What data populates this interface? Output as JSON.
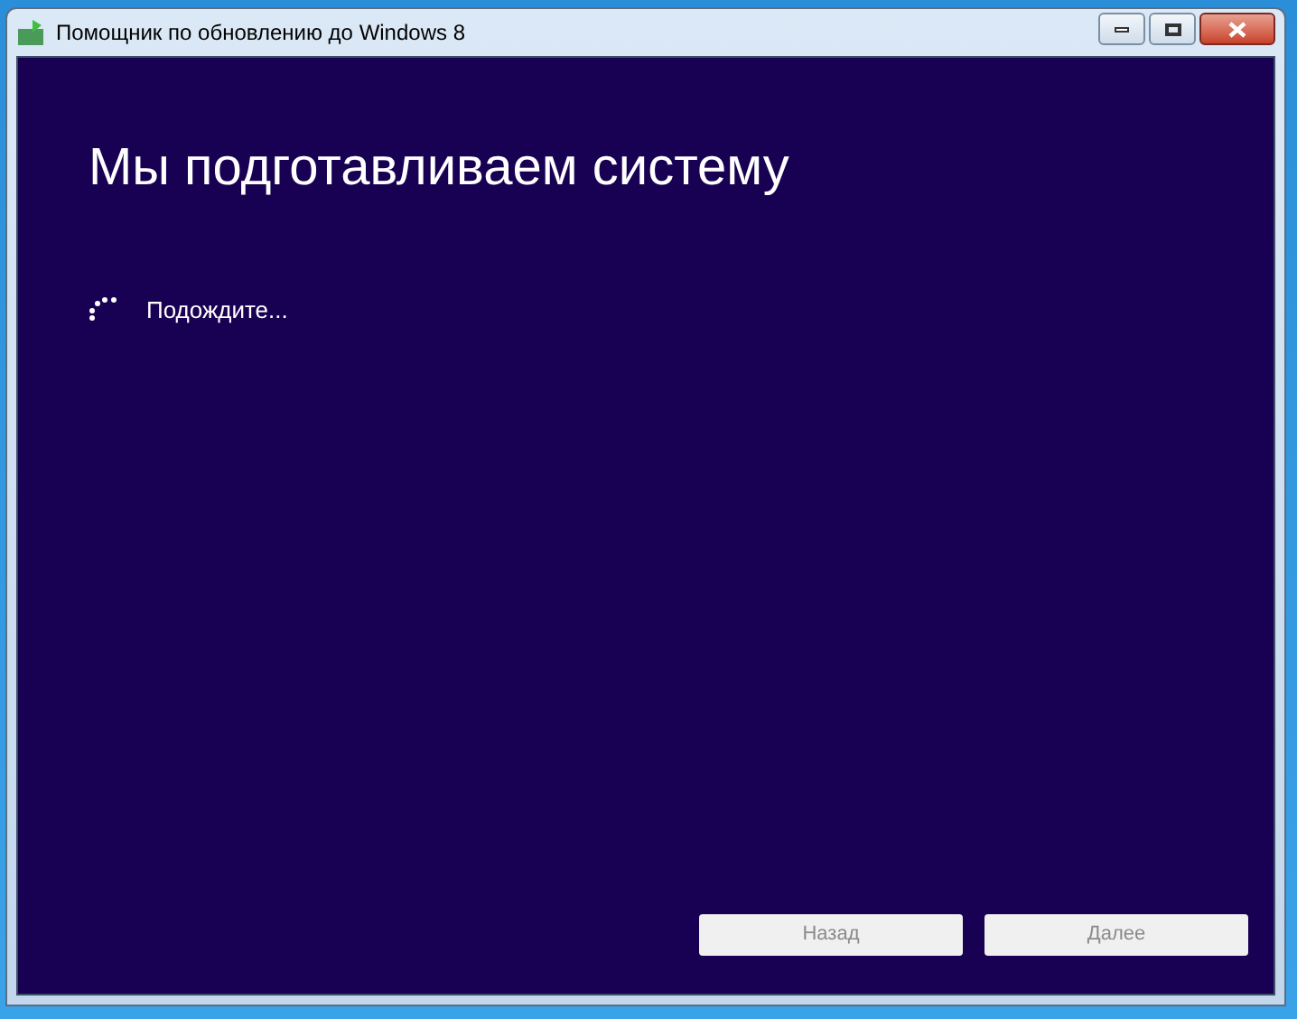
{
  "window": {
    "title": "Помощник по обновлению до Windows 8"
  },
  "heading": "Мы подготавливаем систему",
  "status": {
    "text": "Подождите..."
  },
  "buttons": [
    {
      "label": "Назад",
      "disabled": true
    },
    {
      "label": "Далее",
      "disabled": true
    }
  ]
}
